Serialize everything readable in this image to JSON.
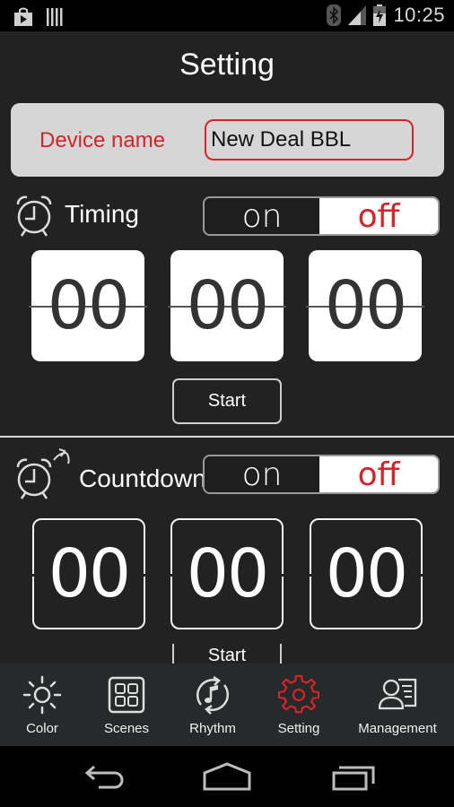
{
  "status_bar": {
    "left_icons": [
      "play-store-icon",
      "barcode-icon"
    ],
    "right_icons": [
      "bluetooth-icon",
      "signal-icon",
      "battery-charging-icon"
    ],
    "time": "10:25"
  },
  "header": {
    "title": "Setting"
  },
  "device": {
    "label": "Device name",
    "value": "New Deal BBL",
    "placeholder": ""
  },
  "timing": {
    "title": "Timing",
    "icon": "alarm-clock-icon",
    "toggle": {
      "on_label": "on",
      "off_label": "off",
      "selected": "off"
    },
    "fields": [
      "00",
      "00",
      "00"
    ],
    "start_label": "Start"
  },
  "countdown": {
    "title": "Countdown",
    "icon": "alarm-clock-countdown-icon",
    "toggle": {
      "on_label": "on",
      "off_label": "off",
      "selected": "off"
    },
    "fields": [
      "00",
      "00",
      "00"
    ],
    "start_label": "Start"
  },
  "tabs": [
    {
      "label": "Color",
      "icon": "sun-icon",
      "active": false
    },
    {
      "label": "Scenes",
      "icon": "grid-icon",
      "active": false
    },
    {
      "label": "Rhythm",
      "icon": "music-sync-icon",
      "active": false
    },
    {
      "label": "Setting",
      "icon": "gear-icon",
      "active": true
    },
    {
      "label": "Management",
      "icon": "user-list-icon",
      "active": false
    }
  ],
  "nav": [
    "back-icon",
    "home-icon",
    "recent-apps-icon"
  ],
  "colors": {
    "accent": "#d0262b",
    "background": "#222222",
    "tabbar": "#262a2b",
    "card": "#d6d6d6"
  }
}
